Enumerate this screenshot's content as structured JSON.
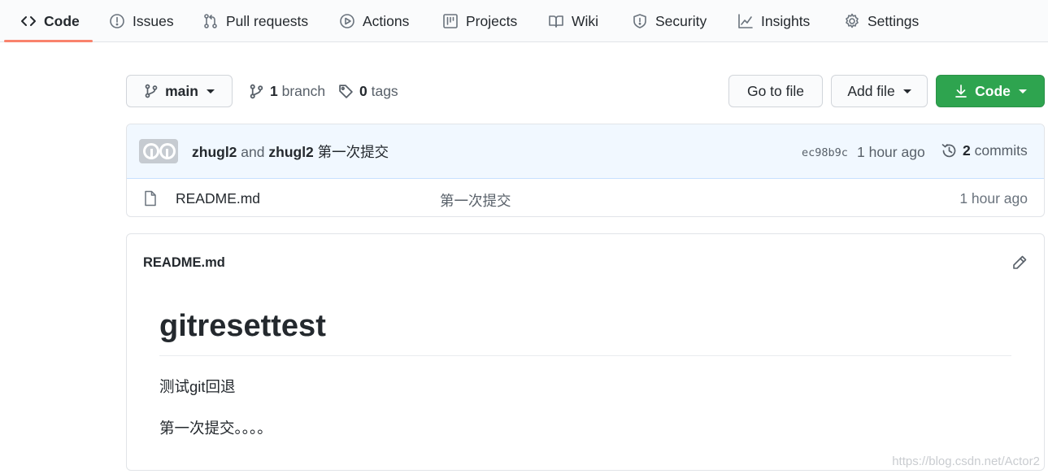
{
  "nav": {
    "tabs": [
      {
        "label": "Code",
        "icon": "code-icon",
        "active": true
      },
      {
        "label": "Issues",
        "icon": "issue-icon"
      },
      {
        "label": "Pull requests",
        "icon": "pull-request-icon"
      },
      {
        "label": "Actions",
        "icon": "play-icon"
      },
      {
        "label": "Projects",
        "icon": "project-icon"
      },
      {
        "label": "Wiki",
        "icon": "book-icon"
      },
      {
        "label": "Security",
        "icon": "shield-icon"
      },
      {
        "label": "Insights",
        "icon": "graph-icon"
      },
      {
        "label": "Settings",
        "icon": "gear-icon"
      }
    ],
    "active_underline_color": "#f9826c"
  },
  "repo_bar": {
    "branch_label": "main",
    "branch_count": "1",
    "branch_word": "branch",
    "tag_count": "0",
    "tag_word": "tags",
    "go_to_file": "Go to file",
    "add_file": "Add file",
    "code_button": "Code",
    "code_button_color": "#2ea44f"
  },
  "latest_commit": {
    "author1": "zhugl2",
    "joiner": "and",
    "author2": "zhugl2",
    "message": "第一次提交",
    "sha": "ec98b9c",
    "time": "1 hour ago",
    "commit_count": "2",
    "commit_word": "commits"
  },
  "files": [
    {
      "name": "README.md",
      "message": "第一次提交",
      "time": "1 hour ago",
      "icon": "file-icon"
    }
  ],
  "readme": {
    "filename": "README.md",
    "heading": "gitresettest",
    "paragraph1": "测试git回退",
    "paragraph2": "第一次提交。。。。"
  },
  "watermark": "https://blog.csdn.net/Actor2"
}
